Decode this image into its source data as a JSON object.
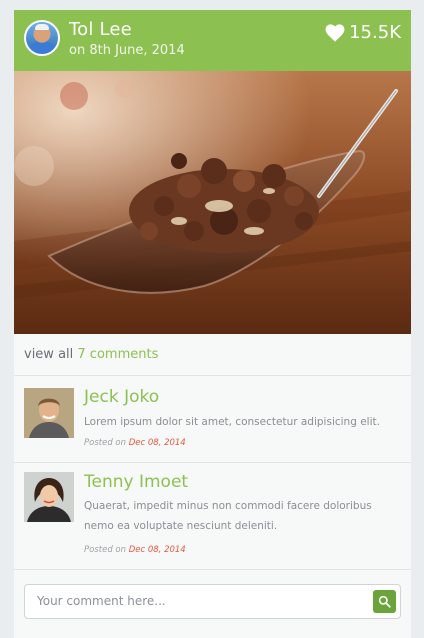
{
  "header": {
    "user_name": "Tol Lee",
    "post_date": "on 8th June, 2014",
    "likes": "15.5K"
  },
  "colors": {
    "accent": "#8cc152",
    "date_red": "#e9573f",
    "send_button": "#6aa53c"
  },
  "view_all": {
    "prefix": "view all",
    "link": "7 comments"
  },
  "comments": [
    {
      "name": "Jeck Joko",
      "text": "Lorem ipsum dolor sit amet, consectetur adipisicing elit.",
      "posted_on_label": "Posted on",
      "date": "Dec 08, 2014"
    },
    {
      "name": "Tenny Imoet",
      "text": "Quaerat, impedit minus non commodi facere doloribus nemo ea voluptate nesciunt deleniti.",
      "posted_on_label": "Posted on",
      "date": "Dec 08, 2014"
    }
  ],
  "composer": {
    "placeholder": "Your comment here..."
  },
  "icons": {
    "like": "heart-icon",
    "send": "search-icon"
  }
}
